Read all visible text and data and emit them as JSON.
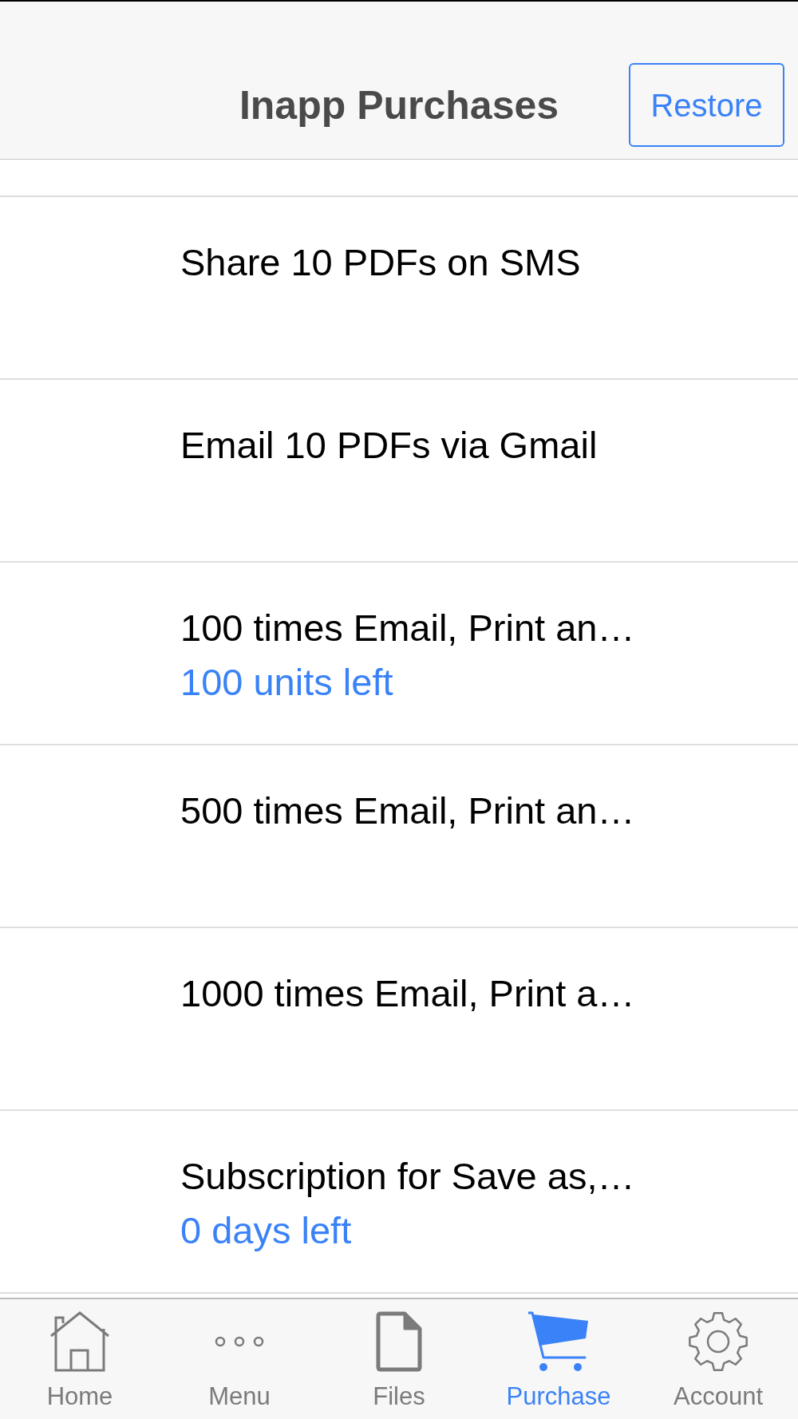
{
  "navigation_bar": {
    "title": "Inapp Purchases",
    "restore_button": "Restore"
  },
  "products": [
    {
      "title": "Share 10 PDFs on SMS"
    },
    {
      "title": "Email 10 PDFs via Gmail"
    },
    {
      "title": "100 times Email, Print an…",
      "remaining": "100 units left"
    },
    {
      "title": "500 times Email, Print an…"
    },
    {
      "title": "1000 times Email, Print a…"
    },
    {
      "title": "Subscription for Save as,…",
      "remaining": "0 days left"
    }
  ],
  "tab_bar": [
    {
      "kind": "home",
      "label": "Home",
      "selected": false
    },
    {
      "kind": "more",
      "label": "Menu",
      "selected": false
    },
    {
      "kind": "files",
      "label": "Files",
      "selected": false
    },
    {
      "kind": "cart",
      "label": "Purchase",
      "selected": true
    },
    {
      "kind": "gear",
      "label": "Account",
      "selected": false
    }
  ]
}
